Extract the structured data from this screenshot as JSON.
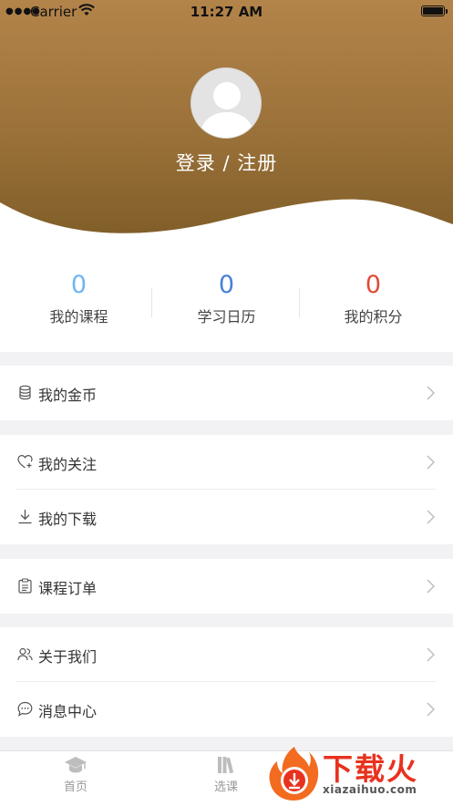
{
  "status_bar": {
    "carrier": "Carrier",
    "time": "11:27 AM"
  },
  "profile": {
    "login_text": "登录 / 注册"
  },
  "stats": [
    {
      "value": "0",
      "label": "我的课程",
      "color": "#6fb6f2"
    },
    {
      "value": "0",
      "label": "学习日历",
      "color": "#4a7fd8"
    },
    {
      "value": "0",
      "label": "我的积分",
      "color": "#e04a3a"
    }
  ],
  "menu": {
    "coins": {
      "label": "我的金币",
      "icon": "coins-icon"
    },
    "follow": {
      "label": "我的关注",
      "icon": "heart-plus-icon"
    },
    "downloads": {
      "label": "我的下载",
      "icon": "download-icon"
    },
    "orders": {
      "label": "课程订单",
      "icon": "clipboard-icon"
    },
    "about": {
      "label": "关于我们",
      "icon": "people-icon"
    },
    "messages": {
      "label": "消息中心",
      "icon": "chat-icon"
    }
  },
  "tabbar": [
    {
      "label": "首页",
      "icon": "graduation-cap-icon"
    },
    {
      "label": "选课",
      "icon": "books-icon"
    }
  ],
  "watermark": {
    "text": "下载火",
    "url": "xiazaihuo.com"
  },
  "colors": {
    "header_top": "#b3844a",
    "header_bottom": "#7e5c27",
    "accent_red": "#e8321e"
  }
}
